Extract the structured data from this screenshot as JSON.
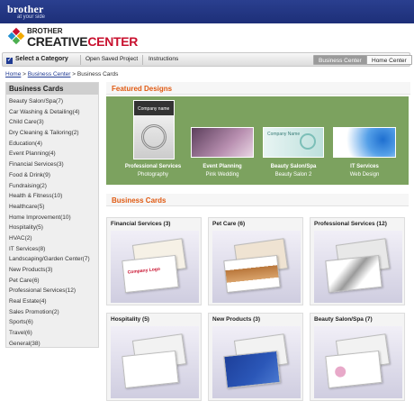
{
  "brand": {
    "name": "brother",
    "tagline": "at your side",
    "logo_line1": "BROTHER",
    "logo_line2a": "CREATIVE",
    "logo_line2b": "CENTER"
  },
  "nav": {
    "select_category": "Select a Category",
    "open_saved": "Open Saved Project",
    "instructions": "Instructions",
    "business_center": "Business Center",
    "home_center": "Home Center"
  },
  "breadcrumb": {
    "home": "Home",
    "sep1": ">",
    "business": "Business Center",
    "sep2": ">",
    "current": "Business Cards"
  },
  "sidebar": {
    "title": "Business Cards",
    "items": [
      "Beauty Salon/Spa(7)",
      "Car Washing & Detailing(4)",
      "Child Care(3)",
      "Dry Cleaning & Tailoring(2)",
      "Education(4)",
      "Event Planning(4)",
      "Financial Services(3)",
      "Food & Drink(9)",
      "Fundraising(2)",
      "Health & Fitness(10)",
      "Healthcare(5)",
      "Home Improvement(10)",
      "Hospitality(5)",
      "HVAC(2)",
      "IT Services(8)",
      "Landscaping/Garden Center(7)",
      "New Products(3)",
      "Pet Care(6)",
      "Professional Services(12)",
      "Real Estate(4)",
      "Sales Promotion(2)",
      "Sports(6)",
      "Travel(6)",
      "General(38)"
    ]
  },
  "featured": {
    "title": "Featured Designs",
    "items": [
      {
        "category": "Professional Services",
        "name": "Photography",
        "card_text": "Company name"
      },
      {
        "category": "Event Planning",
        "name": "Pink Wedding",
        "card_text": ""
      },
      {
        "category": "Beauty Salon/Spa",
        "name": "Beauty Salon 2",
        "card_text": "Company Name"
      },
      {
        "category": "IT Services",
        "name": "Web Design",
        "card_text": ""
      }
    ]
  },
  "cards_section": {
    "title": "Business Cards",
    "tiles": [
      {
        "title": "Financial Services (3)",
        "accent": "#c8102e",
        "card_text": "Company Logo"
      },
      {
        "title": "Pet Care (6)",
        "accent": "#b9773b",
        "card_text": ""
      },
      {
        "title": "Professional Services (12)",
        "accent": "#888888",
        "card_text": ""
      },
      {
        "title": "Hospitality (5)",
        "accent": "#7a9a6a",
        "card_text": ""
      },
      {
        "title": "New Products (3)",
        "accent": "#2b57b8",
        "card_text": ""
      },
      {
        "title": "Beauty Salon/Spa (7)",
        "accent": "#c76b9e",
        "card_text": ""
      }
    ]
  },
  "colors": {
    "topbar": "#1d2f78",
    "accent_orange": "#e05a12",
    "featured_bg": "#7ca25f"
  }
}
